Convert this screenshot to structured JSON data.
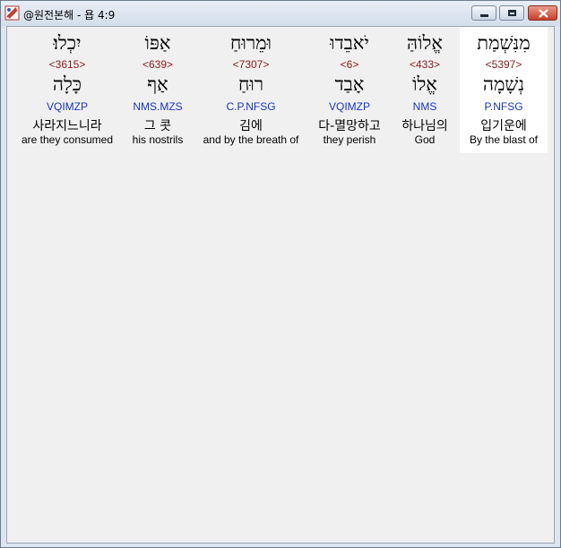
{
  "window": {
    "title": "@원전본해 - 욥 4:9",
    "buttons": {
      "minimize": "minimize",
      "maximize": "maximize",
      "close": "close"
    }
  },
  "words": [
    {
      "hebrew": "מִנִּשְׁמַת",
      "strong": "<5397>",
      "lemma": "נְשָׁמָה",
      "parse": "P.NFSG",
      "korean": "입기운에",
      "english": "By the blast of",
      "selected": true
    },
    {
      "hebrew": "אֱלוֹהַּ",
      "strong": "<433>",
      "lemma": "אֱלוֹ",
      "parse": "NMS",
      "korean": "하나님의",
      "english": "God",
      "selected": false
    },
    {
      "hebrew": "יֹאבֵדוּ",
      "strong": "<6>",
      "lemma": "אָבַד",
      "parse": "VQIMZP",
      "korean": "다-멸망하고",
      "english": "they perish",
      "selected": false
    },
    {
      "hebrew": "וּמֵרוּחַ",
      "strong": "<7307>",
      "lemma": "רוּחַ",
      "parse": "C.P.NFSG",
      "korean": "김에",
      "english": "and by the breath of",
      "selected": false
    },
    {
      "hebrew": "אַפּוֹ",
      "strong": "<639>",
      "lemma": "אַף",
      "parse": "NMS.MZS",
      "korean": "그 콧",
      "english": "his nostrils",
      "selected": false
    },
    {
      "hebrew": "יִכְלוּ׃",
      "strong": "<3615>",
      "lemma": "כָּלָה",
      "parse": "VQIMZP",
      "korean": "사라지느니라",
      "english": "are they consumed",
      "selected": false
    }
  ]
}
